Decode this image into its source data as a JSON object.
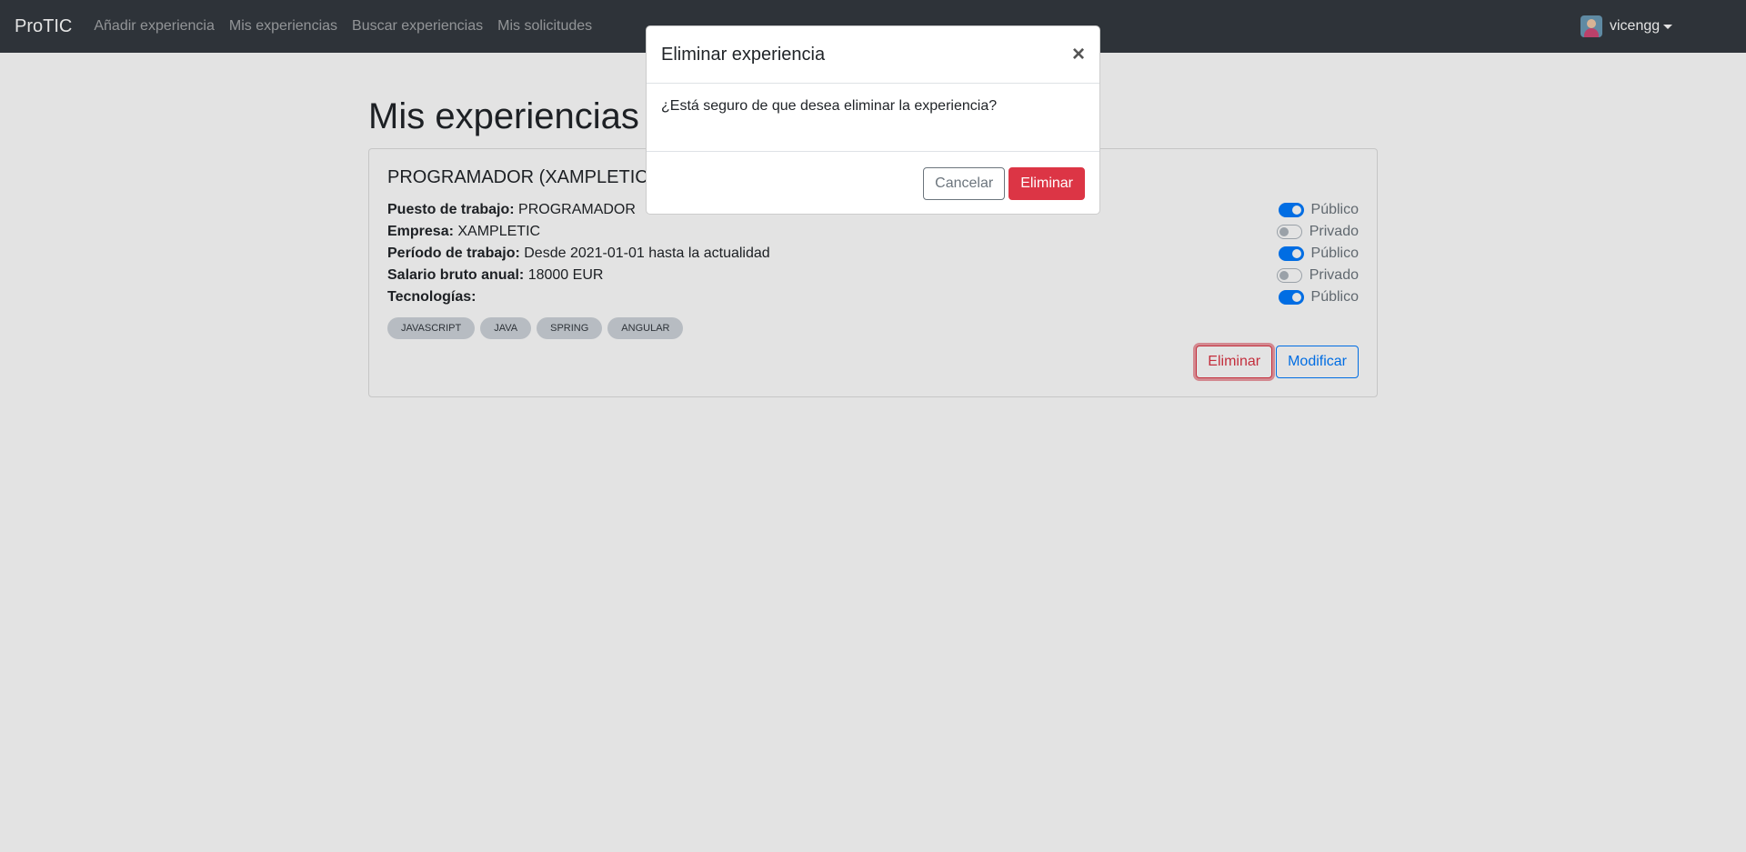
{
  "navbar": {
    "brand": "ProTIC",
    "links": [
      "Añadir experiencia",
      "Mis experiencias",
      "Buscar experiencias",
      "Mis solicitudes"
    ],
    "username": "vicengg"
  },
  "page": {
    "title": "Mis experiencias"
  },
  "experience": {
    "title": "PROGRAMADOR (XAMPLETIC)",
    "fields": [
      {
        "label": "Puesto de trabajo:",
        "value": "PROGRAMADOR",
        "visibility": "Público",
        "public": true
      },
      {
        "label": "Empresa:",
        "value": "XAMPLETIC",
        "visibility": "Privado",
        "public": false
      },
      {
        "label": "Período de trabajo:",
        "value": "Desde 2021-01-01 hasta la actualidad",
        "visibility": "Público",
        "public": true
      },
      {
        "label": "Salario bruto anual:",
        "value": "18000 EUR",
        "visibility": "Privado",
        "public": false
      },
      {
        "label": "Tecnologías:",
        "value": "",
        "visibility": "Público",
        "public": true
      }
    ],
    "tags": [
      "JAVASCRIPT",
      "JAVA",
      "SPRING",
      "ANGULAR"
    ],
    "delete_label": "Eliminar",
    "edit_label": "Modificar"
  },
  "modal": {
    "title": "Eliminar experiencia",
    "close_glyph": "×",
    "message": "¿Está seguro de que desea eliminar la experiencia?",
    "cancel_label": "Cancelar",
    "confirm_label": "Eliminar"
  },
  "colors": {
    "navbar_bg": "#343a40",
    "primary": "#007bff",
    "danger": "#dc3545"
  }
}
